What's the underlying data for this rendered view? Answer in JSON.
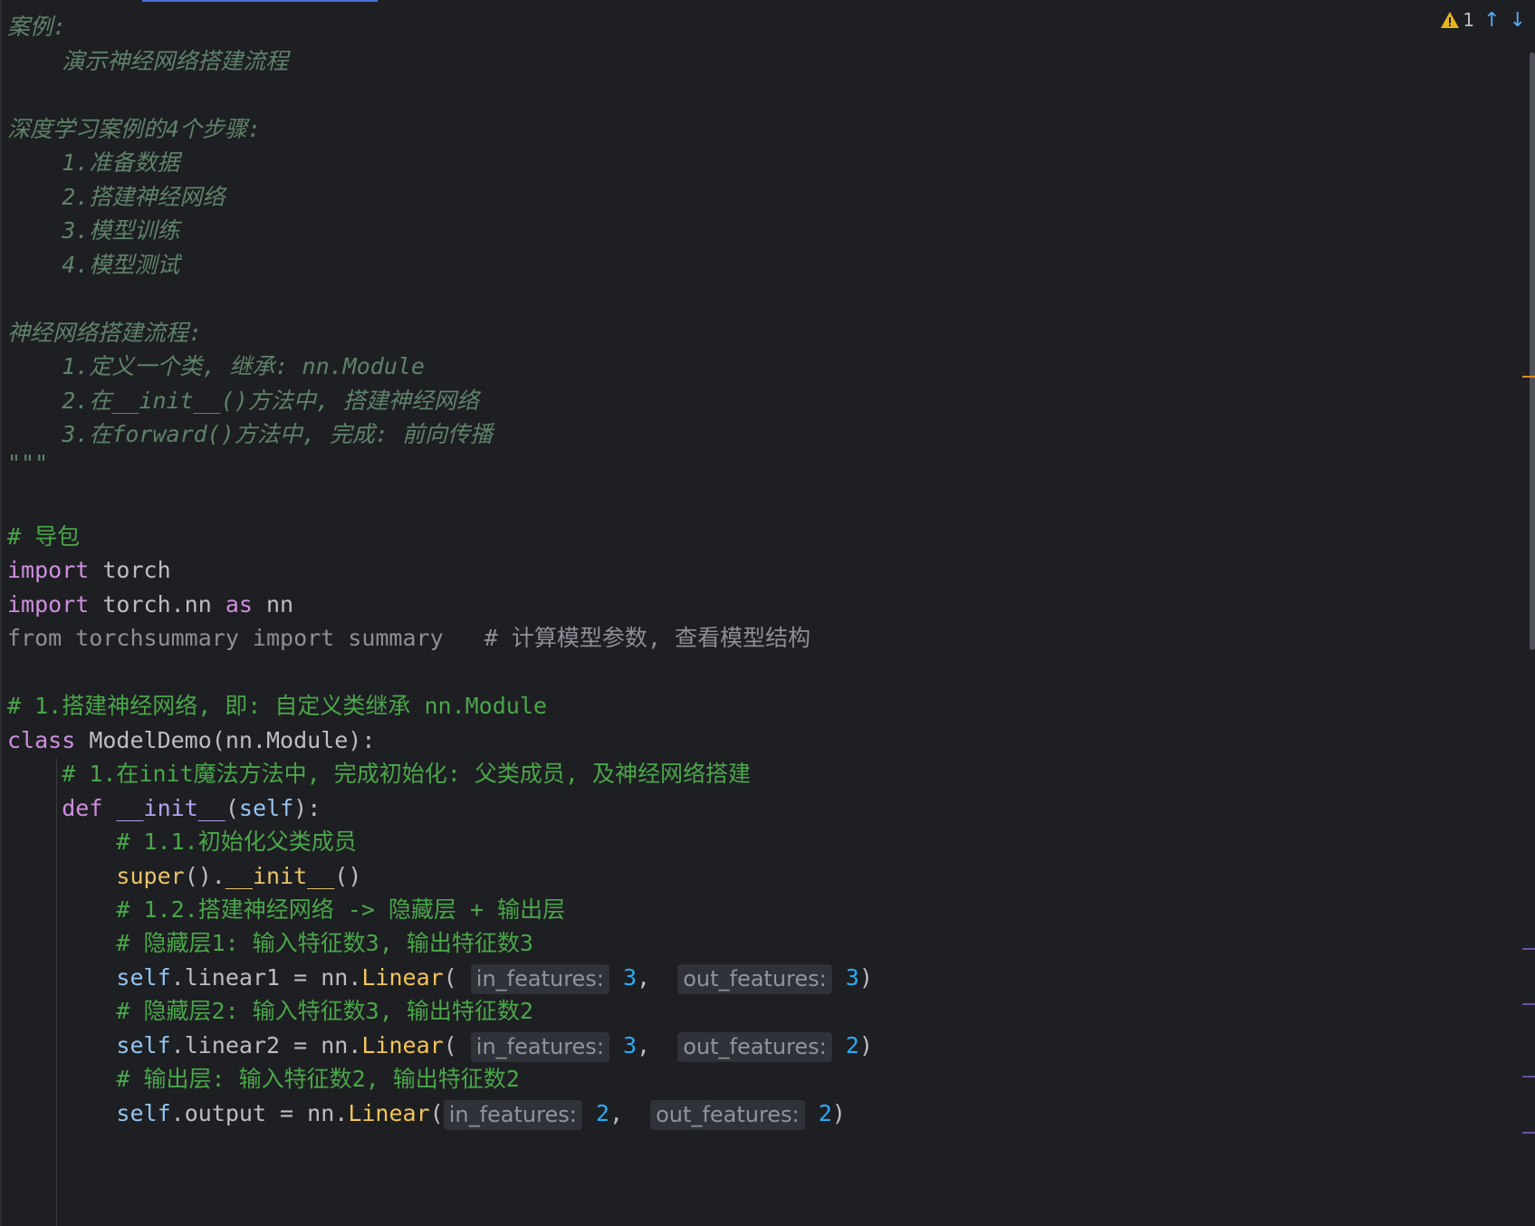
{
  "editor": {
    "inspections": {
      "warning_count": "1",
      "warning_icon": "warning-triangle-icon",
      "prev_icon": "arrow-up-icon",
      "next_icon": "arrow-down-icon",
      "colors": {
        "warning": "#e8b41c",
        "arrow": "#56a8f5"
      }
    },
    "scroll_markers": [
      {
        "kind": "warning",
        "color": "#e08a1c"
      },
      {
        "kind": "change",
        "color": "#6e4fa8"
      },
      {
        "kind": "change",
        "color": "#6e4fa8"
      },
      {
        "kind": "change",
        "color": "#6e4fa8"
      },
      {
        "kind": "change",
        "color": "#6e4fa8"
      }
    ],
    "code": {
      "l1": "案例:",
      "l2": "演示神经网络搭建流程",
      "l3": "深度学习案例的4个步骤:",
      "l4": "1.准备数据",
      "l5": "2.搭建神经网络",
      "l6": "3.模型训练",
      "l7": "4.模型测试",
      "l8": "神经网络搭建流程:",
      "l9": "1.定义一个类, 继承: nn.Module",
      "l10": "2.在__init__()方法中, 搭建神经网络",
      "l11": "3.在forward()方法中, 完成: 前向传播",
      "l12": "\"\"\"",
      "l13": "# 导包",
      "l14_kw": "import",
      "l14_rest": " torch",
      "l15_kw": "import",
      "l15_a": " torch.nn ",
      "l15_as": "as",
      "l15_b": " nn",
      "l16_code": "from torchsummary import summary",
      "l16_cmt": "# 计算模型参数, 查看模型结构",
      "l17": "# 1.搭建神经网络, 即: 自定义类继承 nn.Module",
      "l18_kw": "class",
      "l18_rest": " ModelDemo(nn.Module):",
      "l19": "# 1.在init魔法方法中, 完成初始化: 父类成员, 及神经网络搭建",
      "l20_kw": "def",
      "l20_fn": "__init__",
      "l20_a": "(",
      "l20_self": "self",
      "l20_b": "):",
      "l21": "# 1.1.初始化父类成员",
      "l22_super": "super",
      "l22_a": "().",
      "l22_init": "__init__",
      "l22_b": "()",
      "l23": "# 1.2.搭建神经网络 -> 隐藏层 + 输出层",
      "l24": "# 隐藏层1: 输入特征数3, 输出特征数3",
      "l25_self": "self",
      "l25_a": ".linear1 = nn.",
      "l25_lin": "Linear",
      "l25_hint1": "in_features:",
      "l25_v1": "3",
      "l25_hint2": "out_features:",
      "l25_v2": "3",
      "l26": "# 隐藏层2: 输入特征数3, 输出特征数2",
      "l27_self": "self",
      "l27_a": ".linear2 = nn.",
      "l27_lin": "Linear",
      "l27_hint1": "in_features:",
      "l27_v1": "3",
      "l27_hint2": "out_features:",
      "l27_v2": "2",
      "l28": "# 输出层: 输入特征数2, 输出特征数2",
      "l29_self": "self",
      "l29_a": ".output = nn.",
      "l29_lin": "Linear",
      "l29_hint1": "in_features:",
      "l29_v1": "2",
      "l29_hint2": "out_features:",
      "l29_v2": "2"
    }
  }
}
